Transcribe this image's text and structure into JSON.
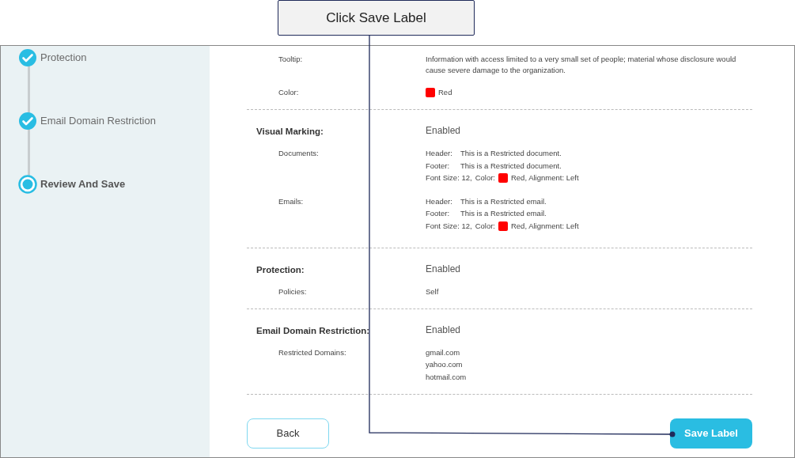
{
  "callout": {
    "text": "Click Save Label"
  },
  "steps": [
    {
      "label": "Protection",
      "completed": true,
      "selected": false
    },
    {
      "label": "Email Domain Restriction",
      "completed": true,
      "selected": false
    },
    {
      "label": "Review And Save",
      "completed": false,
      "selected": true
    }
  ],
  "sections": [
    {
      "rows": [
        {
          "kind": "text",
          "label": "Tooltip:",
          "value": "Information with access limited to a very small set of people; material whose disclosure would cause severe damage to the organization."
        },
        {
          "kind": "color",
          "label": "Color:",
          "color": "#ff0000",
          "value": "Red"
        }
      ]
    },
    {
      "heading": "Visual Marking:",
      "status": "Enabled",
      "rows": [
        {
          "kind": "marking",
          "label": "Documents:",
          "header_label": "Header:",
          "header": "This is a Restricted document.",
          "footer_label": "Footer:",
          "footer": "This is a Restricted document.",
          "font_size": "Font Size: 12,",
          "color_label": "Color:",
          "color": "#ff0000",
          "color_text": "Red, Alignment: Left"
        },
        {
          "kind": "marking",
          "label": "Emails:",
          "header_label": "Header:",
          "header": "This is a Restricted email.",
          "footer_label": "Footer:",
          "footer": "This is a Restricted email.",
          "font_size": "Font Size: 12,",
          "color_label": "Color:",
          "color": "#ff0000",
          "color_text": "Red, Alignment: Left"
        }
      ]
    },
    {
      "heading": "Protection:",
      "status": "Enabled",
      "rows": [
        {
          "kind": "text",
          "label": "Policies:",
          "value": "Self"
        }
      ]
    },
    {
      "heading": "Email Domain Restriction:",
      "status": "Enabled",
      "rows": [
        {
          "kind": "list",
          "label": "Restricted Domains:",
          "values": [
            "gmail.com",
            "yahoo.com",
            "hotmail.com"
          ]
        }
      ]
    }
  ],
  "buttons": {
    "back": "Back",
    "save": "Save Label"
  }
}
